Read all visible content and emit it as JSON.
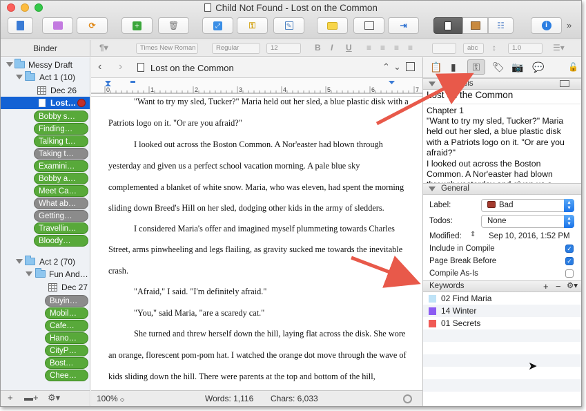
{
  "window": {
    "title": "Child Not Found - Lost on the Common"
  },
  "binder": {
    "header": "Binder",
    "items": [
      {
        "label": "Messy Draft",
        "kind": "folder",
        "depth": 0
      },
      {
        "label": "Act 1 (10)",
        "kind": "folder",
        "depth": 1
      },
      {
        "label": "Dec 26",
        "kind": "grid",
        "depth": 2
      },
      {
        "label": "Lost…",
        "kind": "selected",
        "depth": 2
      },
      {
        "label": "Bobby s…",
        "kind": "pill-green"
      },
      {
        "label": "Finding…",
        "kind": "pill-green"
      },
      {
        "label": "Talking t…",
        "kind": "pill-green"
      },
      {
        "label": "Taking t…",
        "kind": "pill-gray"
      },
      {
        "label": "Examini…",
        "kind": "pill-green"
      },
      {
        "label": "Bobby a…",
        "kind": "pill-green"
      },
      {
        "label": "Meet Ca…",
        "kind": "pill-green"
      },
      {
        "label": "What ab…",
        "kind": "pill-gray"
      },
      {
        "label": "Getting…",
        "kind": "pill-gray"
      },
      {
        "label": "Travellin…",
        "kind": "pill-green"
      },
      {
        "label": "Bloody…",
        "kind": "pill-green"
      },
      {
        "label": "Act 2 (70)",
        "kind": "folder",
        "depth": 1
      },
      {
        "label": "Fun And…",
        "kind": "folder",
        "depth": 2
      },
      {
        "label": "Dec 27",
        "kind": "grid",
        "depth": 3
      },
      {
        "label": "Buyin…",
        "kind": "pill-gray"
      },
      {
        "label": "Mobil…",
        "kind": "pill-green"
      },
      {
        "label": "Cafe…",
        "kind": "pill-green"
      },
      {
        "label": "Hano…",
        "kind": "pill-green"
      },
      {
        "label": "CityP…",
        "kind": "pill-green"
      },
      {
        "label": "Bost…",
        "kind": "pill-green"
      },
      {
        "label": "Chee…",
        "kind": "pill-green"
      }
    ]
  },
  "formatbar": {
    "font": "Times New Roman",
    "style": "Regular",
    "size": "12",
    "linespacing": "1.0",
    "abc": "abc"
  },
  "editor": {
    "doc_title": "Lost on the Common",
    "paragraphs": [
      "\"Want to try my sled, Tucker?\" Maria held out her sled, a blue plastic disk with a",
      "Patriots logo on it. \"Or are you afraid?\"",
      "I looked out across the Boston Common.  A Nor'easter had blown through",
      "yesterday and given us a perfect school vacation morning.  A pale blue sky",
      "complemented a blanket of white snow. Maria, who was eleven, had spent the morning",
      "sliding down Breed's Hill on her sled, dodging other kids in the army of sledders.",
      "I considered Maria's offer and imagined myself plummeting towards Charles",
      "Street, arms pinwheeling and legs flailing, as gravity sucked me towards the inevitable",
      "crash.",
      "\"Afraid,\" I said.  \"I'm definitely afraid.\"",
      "\"You,\" said Maria, \"are a scaredy cat.\"",
      "She turned and threw herself down the hill, laying flat across the disk.  She wore",
      "an orange, florescent pom-pom hat. I watched the orange dot move through the wave of",
      "kids sliding down the hill.  There were parents at the top and bottom of the hill,"
    ],
    "zoom": "100%",
    "words": "Words: 1,116",
    "chars": "Chars: 6,033"
  },
  "inspector": {
    "synopsis_header": "Synopsis",
    "synopsis_title": "Lost on the Common",
    "synopsis_lines": [
      "Chapter 1",
      "\"Want to try my sled, Tucker?\" Maria",
      "held out her sled, a blue plastic disk",
      "with a Patriots logo on it. \"Or are you",
      "afraid?\"",
      "I looked out across the Boston",
      "Common. A Nor'easter had blown",
      "through yesterday and given us a"
    ],
    "general_header": "General",
    "label_caption": "Label:",
    "label_value": "Bad",
    "label_color": "#a33a2e",
    "todos_caption": "Todos:",
    "todos_value": "None",
    "modified_caption": "Modified:",
    "modified_value": "Sep 10, 2016, 1:52 PM",
    "include_in_compile": "Include in Compile",
    "page_break_before": "Page Break Before",
    "compile_as_is": "Compile As-Is",
    "keywords_header": "Keywords",
    "keywords": [
      {
        "label": "02 Find Maria",
        "color": "#bfe3f7"
      },
      {
        "label": "14 Winter",
        "color": "#8c5cf2"
      },
      {
        "label": "01 Secrets",
        "color": "#f05a55"
      }
    ]
  },
  "colors": {
    "selection": "#1362d4",
    "pill_green": "#58a93a",
    "pill_gray": "#8b8b8b",
    "annotation_arrow": "#e8594a"
  }
}
